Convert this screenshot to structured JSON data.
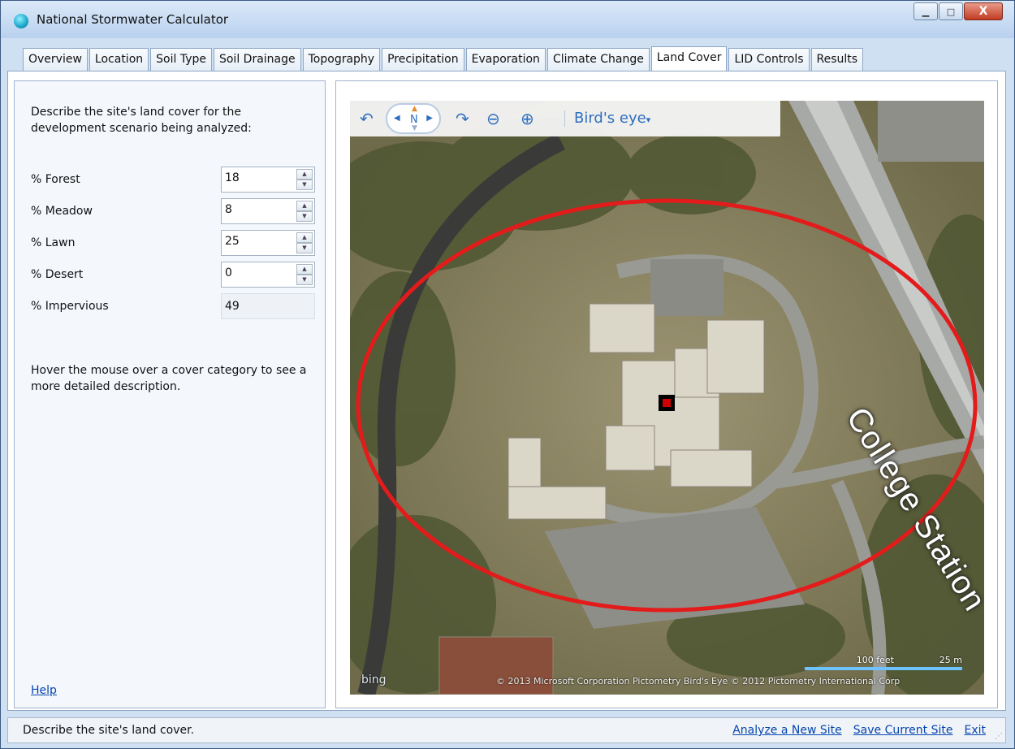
{
  "window": {
    "title": "National Stormwater Calculator",
    "controls": {
      "minimize": "▁",
      "maximize": "□",
      "close": "X"
    }
  },
  "tabs": [
    {
      "label": "Overview",
      "active": false
    },
    {
      "label": "Location",
      "active": false
    },
    {
      "label": "Soil Type",
      "active": false
    },
    {
      "label": "Soil Drainage",
      "active": false
    },
    {
      "label": "Topography",
      "active": false
    },
    {
      "label": "Precipitation",
      "active": false
    },
    {
      "label": "Evaporation",
      "active": false
    },
    {
      "label": "Climate Change",
      "active": false
    },
    {
      "label": "Land Cover",
      "active": true
    },
    {
      "label": "LID Controls",
      "active": false
    },
    {
      "label": "Results",
      "active": false
    }
  ],
  "land_cover": {
    "intro": "Describe the site's land cover for the development scenario being analyzed:",
    "fields": [
      {
        "label": "% Forest",
        "value": "18"
      },
      {
        "label": "% Meadow",
        "value": "8"
      },
      {
        "label": "% Lawn",
        "value": "25"
      },
      {
        "label": "% Desert",
        "value": "0"
      }
    ],
    "impervious": {
      "label": "% Impervious",
      "value": "49"
    },
    "hover_tip": "Hover the mouse over a cover category to see a more detailed description.",
    "help_link": "Help"
  },
  "map": {
    "view_mode": "Bird's eye",
    "compass_label": "N",
    "road_label": "College Station",
    "scale_feet": "100 feet",
    "scale_meters": "25 m",
    "copyright": "© 2013 Microsoft Corporation   Pictometry Bird's Eye © 2012 Pictometry International Corp",
    "brand": "bing",
    "colors": {
      "site_circle": "#e31b1b",
      "site_marker": "#d10000"
    }
  },
  "status": {
    "message": "Describe the site's land cover.",
    "links": [
      "Analyze a New Site",
      "Save Current Site",
      "Exit"
    ]
  }
}
